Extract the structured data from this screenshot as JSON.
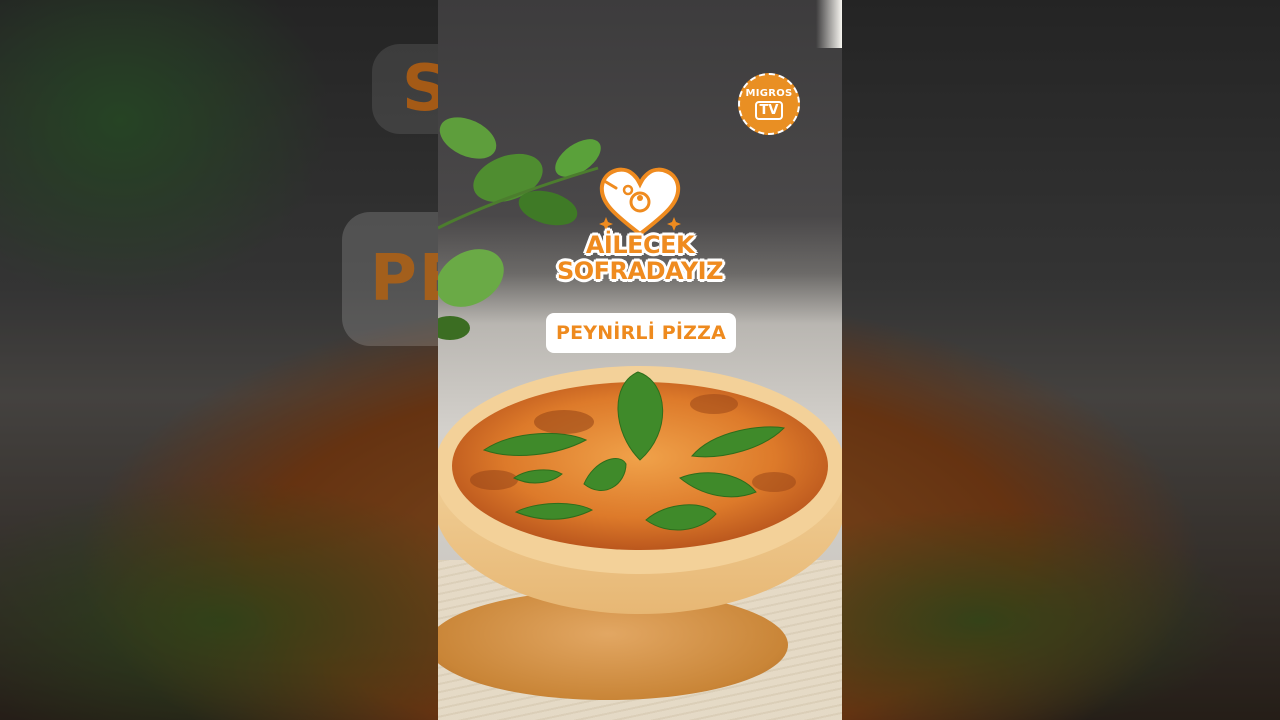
{
  "overlay": {
    "channel_logo": {
      "line1": "MIGROS",
      "line2": "TV"
    },
    "brand": {
      "line1": "AİLECEK",
      "line2": "SOFRADAYIZ"
    },
    "recipe_title": "PEYNİRLİ PİZZA"
  },
  "background": {
    "blurred_text_top": "S                         Z",
    "blurred_text_middle": "PE                      ZA"
  },
  "colors": {
    "accent": "#ef8b1f",
    "logo_bg": "#e98f23",
    "pill_bg": "#ffffff"
  }
}
